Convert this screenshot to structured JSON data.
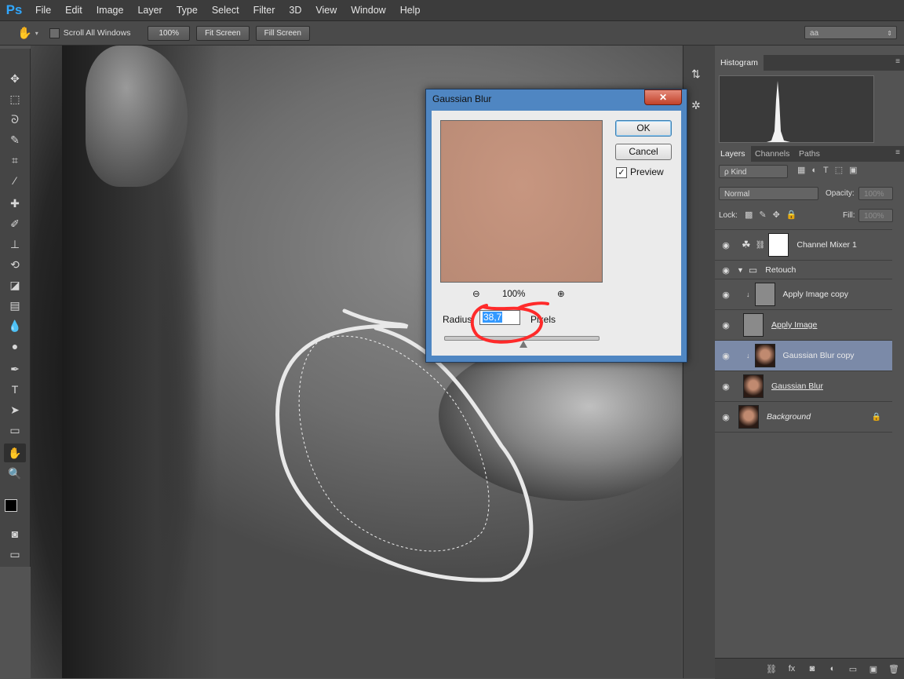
{
  "app": {
    "logo": "Ps"
  },
  "menu": [
    "File",
    "Edit",
    "Image",
    "Layer",
    "Type",
    "Select",
    "Filter",
    "3D",
    "View",
    "Window",
    "Help"
  ],
  "options": {
    "scroll_all": "Scroll All Windows",
    "zoom_100": "100%",
    "fit_screen": "Fit Screen",
    "fill_screen": "Fill Screen",
    "workspace_value": "aa"
  },
  "dialog": {
    "title": "Gaussian Blur",
    "close": "✕",
    "ok": "OK",
    "cancel": "Cancel",
    "preview_label": "Preview",
    "preview_checked": "✓",
    "zoom_level": "100%",
    "radius_label": "Radius:",
    "radius_value": "38,7",
    "units": "Pixels",
    "slider_fraction": 0.51
  },
  "panels": {
    "histogram_tab": "Histogram",
    "layers_tab": "Layers",
    "channels_tab": "Channels",
    "paths_tab": "Paths",
    "kind_filter": "ρ Kind",
    "blend_mode": "Normal",
    "opacity_label": "Opacity:",
    "opacity_value": "100%",
    "lock_label": "Lock:",
    "fill_label": "Fill:",
    "fill_value": "100%"
  },
  "layers": [
    {
      "name": "Channel Mixer 1",
      "visible": true,
      "underline": false,
      "italic": false,
      "selected": false
    },
    {
      "name": "Retouch",
      "visible": true,
      "group": true
    },
    {
      "name": "Apply Image copy",
      "visible": true,
      "underline": false,
      "italic": false,
      "selected": false
    },
    {
      "name": "Apply Image",
      "visible": true,
      "underline": true,
      "italic": false,
      "selected": false
    },
    {
      "name": "Gaussian Blur copy",
      "visible": true,
      "underline": false,
      "italic": false,
      "selected": true
    },
    {
      "name": "Gaussian Blur",
      "visible": true,
      "underline": true,
      "italic": false,
      "selected": false
    },
    {
      "name": "Background",
      "visible": true,
      "underline": false,
      "italic": true,
      "selected": false
    }
  ],
  "colors": {
    "selected_layer": "#7b8aa8",
    "annotation_circle": "#ff2a2a",
    "annotation_outline": "#e8e8e8"
  }
}
